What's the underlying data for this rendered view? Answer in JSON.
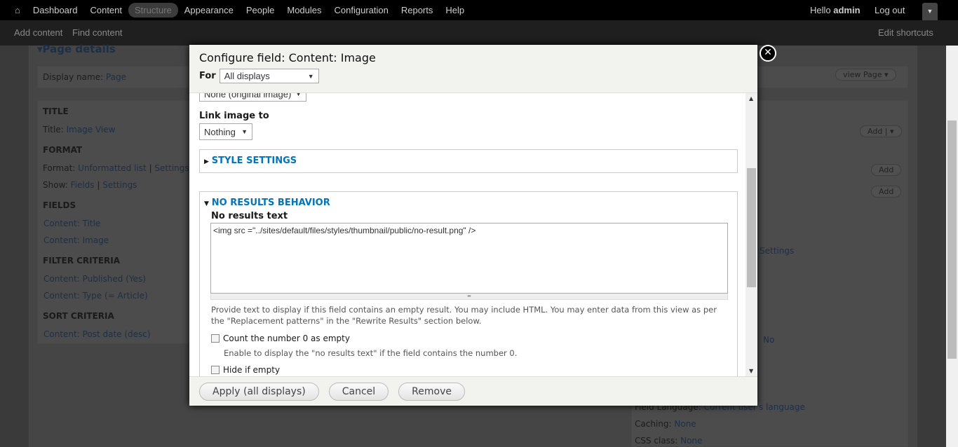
{
  "toolbar": {
    "items": [
      "Dashboard",
      "Content",
      "Structure",
      "Appearance",
      "People",
      "Modules",
      "Configuration",
      "Reports",
      "Help"
    ],
    "active": "Structure",
    "hello": "Hello",
    "user": "admin",
    "logout": "Log out"
  },
  "shortcuts": {
    "items": [
      "Add content",
      "Find content"
    ],
    "edit": "Edit shortcuts"
  },
  "background": {
    "page_details": "Page details",
    "display_name_label": "Display name:",
    "display_name": "Page",
    "view_page": "view Page",
    "title_hdr": "TITLE",
    "title_label": "Title:",
    "title_value": "Image View",
    "format_hdr": "FORMAT",
    "format_label": "Format:",
    "format_value": "Unformatted list",
    "settings": "Settings",
    "show_label": "Show:",
    "show_value": "Fields",
    "fields_hdr": "FIELDS",
    "fields": [
      "Content: Title",
      "Content: Image"
    ],
    "filter_hdr": "FILTER CRITERIA",
    "filters": [
      "Content: Published (Yes)",
      "Content: Type (= Article)"
    ],
    "sort_hdr": "SORT CRITERIA",
    "sorts": [
      "Content: Post date (desc)"
    ],
    "add": "Add",
    "settings_right": "Settings",
    "no": "No",
    "field_language_label": "Field Language:",
    "field_language": "Current user's language",
    "caching_label": "Caching:",
    "caching": "None",
    "css_label": "CSS class:",
    "css": "None"
  },
  "modal": {
    "title": "Configure field: Content: Image",
    "for_label": "For",
    "for_value": "All displays",
    "image_style_value": "None (original image)",
    "link_label": "Link image to",
    "link_value": "Nothing",
    "style_settings": "STYLE SETTINGS",
    "no_results": "NO RESULTS BEHAVIOR",
    "no_results_text_label": "No results text",
    "no_results_text": "<img src =\"../sites/default/files/styles/thumbnail/public/no-result.png\" />",
    "no_results_desc": "Provide text to display if this field contains an empty result. You may include HTML. You may enter data from this view as per the \"Replacement patterns\" in the \"Rewrite Results\" section below.",
    "count_zero": "Count the number 0 as empty",
    "count_zero_desc": "Enable to display the \"no results text\" if the field contains the number 0.",
    "hide_empty": "Hide if empty",
    "buttons": {
      "apply": "Apply (all displays)",
      "cancel": "Cancel",
      "remove": "Remove"
    }
  }
}
